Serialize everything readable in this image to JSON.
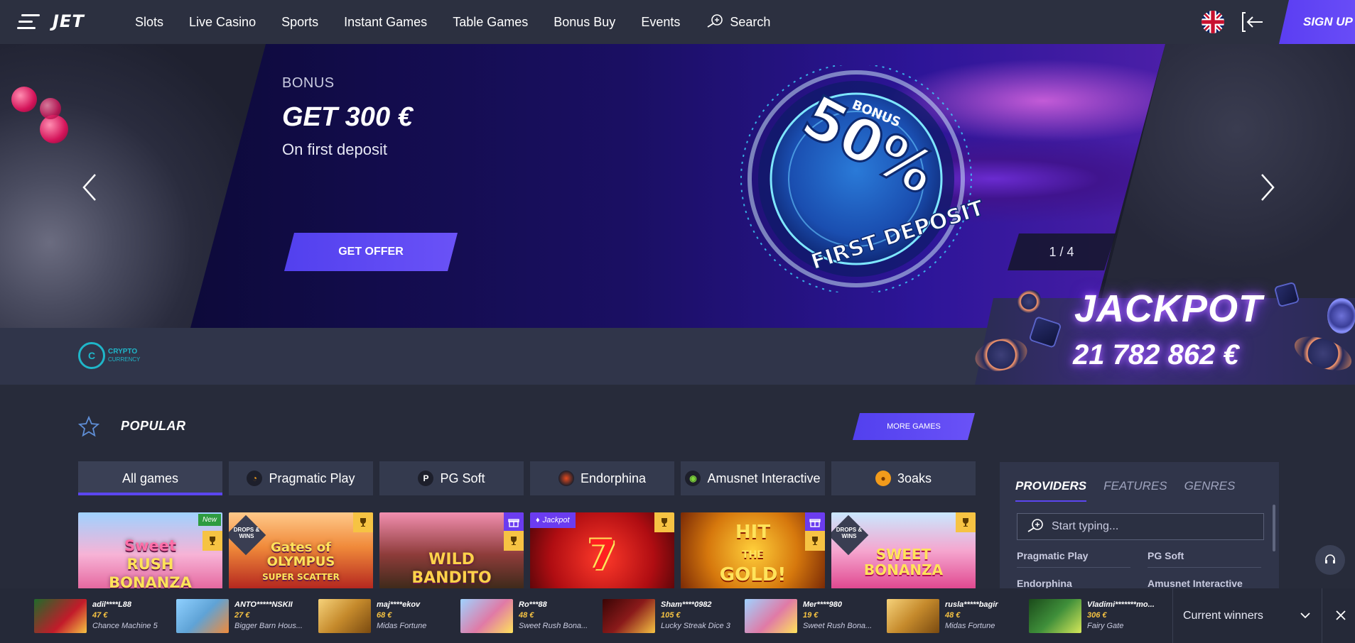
{
  "header": {
    "logo": "JET",
    "nav": [
      "Slots",
      "Live Casino",
      "Sports",
      "Instant Games",
      "Table Games",
      "Bonus Buy",
      "Events"
    ],
    "search_label": "Search",
    "signup_label": "SIGN UP",
    "language_icon": "uk-flag-icon"
  },
  "hero": {
    "kicker": "BONUS",
    "title": "GET 300 €",
    "subtitle": "On first deposit",
    "cta_label": "GET OFFER",
    "badge_bonus": "BONUS",
    "badge_percent": "50%",
    "badge_text": "FIRST DEPOSIT",
    "counter": "1 / 4"
  },
  "crypto": {
    "title": "CRYPTO",
    "subtitle": "CURRENCY"
  },
  "jackpot": {
    "title": "JACKPOT",
    "amount": "21 782 862 €"
  },
  "popular": {
    "title": "POPULAR",
    "more_label": "MORE GAMES",
    "tabs": [
      {
        "label": "All games"
      },
      {
        "label": "Pragmatic Play"
      },
      {
        "label": "PG Soft"
      },
      {
        "label": "Endorphina"
      },
      {
        "label": "Amusnet Interactive"
      },
      {
        "label": "3oaks"
      }
    ],
    "games": [
      {
        "name": "Sweet Rush Bonanza",
        "badge": "New"
      },
      {
        "name": "Gates of Olympus Super Scatter",
        "badge": "DROPS & WINS"
      },
      {
        "name": "Wild Bandito",
        "badge": ""
      },
      {
        "name": "7",
        "badge": "Jackpot"
      },
      {
        "name": "Hit the Gold!",
        "badge": ""
      },
      {
        "name": "Sweet Bonanza",
        "badge": "DROPS & WINS"
      }
    ],
    "game_title_lines": [
      [
        "Sweet",
        "RUSH",
        "BONANZA"
      ],
      [
        "Gates of",
        "OLYMPUS",
        "SUPER SCATTER"
      ],
      [
        "WILD",
        "BANDITO"
      ],
      [
        "7"
      ],
      [
        "HIT",
        "THE",
        "GOLD!"
      ],
      [
        "SWEET",
        "BONANZA"
      ]
    ]
  },
  "providers_panel": {
    "tabs": [
      "PROVIDERS",
      "FEATURES",
      "GENRES"
    ],
    "search_placeholder": "Start typing...",
    "items": [
      "Pragmatic Play",
      "PG Soft",
      "Endorphina",
      "Amusnet Interactive"
    ]
  },
  "winners": {
    "label": "Current winners",
    "list": [
      {
        "user": "adil****L88",
        "amount": "47 €",
        "game": "Chance Machine 5",
        "color": "#c21b2a"
      },
      {
        "user": "ANTO*****NSKII",
        "amount": "27 €",
        "game": "Bigger Barn Hous...",
        "color": "#5fa3d6"
      },
      {
        "user": "maj****ekov",
        "amount": "68 €",
        "game": "Midas Fortune",
        "color": "#c58a2c"
      },
      {
        "user": "Ro***88",
        "amount": "48 €",
        "game": "Sweet Rush Bona...",
        "color": "#e07aa6"
      },
      {
        "user": "Sham****0982",
        "amount": "105 €",
        "game": "Lucky Streak Dice 3",
        "color": "#8a1a1a"
      },
      {
        "user": "Mer****980",
        "amount": "19 €",
        "game": "Sweet Rush Bona...",
        "color": "#e07aa6"
      },
      {
        "user": "rusla*****bagir",
        "amount": "48 €",
        "game": "Midas Fortune",
        "color": "#c58a2c"
      },
      {
        "user": "Vladimi*******mo...",
        "amount": "306 €",
        "game": "Fairy Gate",
        "color": "#3f8f3a"
      }
    ]
  },
  "colors": {
    "accent": "#5b46f0",
    "gold": "#f6c343",
    "panel": "#30354a",
    "background": "#272b3a"
  }
}
